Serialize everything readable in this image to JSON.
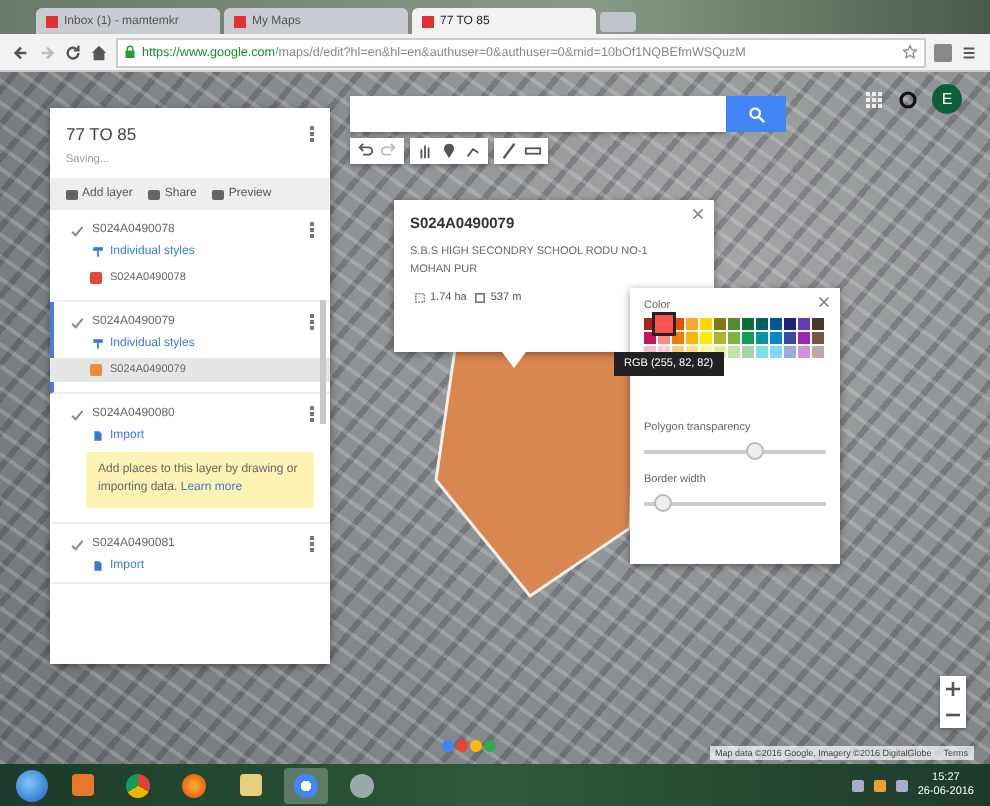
{
  "browser": {
    "tabs": [
      {
        "title": "Inbox (1) - mamtemkr",
        "selected": false
      },
      {
        "title": "My Maps",
        "selected": false
      },
      {
        "title": "77 TO 85",
        "selected": true
      }
    ],
    "url_host": "https://www.google.com",
    "url_path": "/maps/d/edit?hl=en&hl=en&authuser=0&authuser=0&mid=10bOf1NQBEfmWSQuzM"
  },
  "account": {
    "initial": "E"
  },
  "map_panel": {
    "title": "77 TO 85",
    "status": "Saving...",
    "actions": [
      "Add layer",
      "Share",
      "Preview"
    ],
    "layers": [
      {
        "name": "S024A0490078",
        "checked": true,
        "selected": false,
        "kind": "styled",
        "style_label": "Individual styles",
        "feature": {
          "name": "S024A0490078",
          "color": "#e04a3a",
          "selected": false
        }
      },
      {
        "name": "S024A0490079",
        "checked": true,
        "selected": true,
        "kind": "styled",
        "style_label": "Individual styles",
        "feature": {
          "name": "S024A0490079",
          "color": "#f08a3c",
          "selected": true
        }
      },
      {
        "name": "S024A0490080",
        "checked": true,
        "selected": false,
        "kind": "empty",
        "import_label": "Import",
        "note": "Add places to this layer by drawing or importing data.",
        "note_link": "Learn more"
      },
      {
        "name": "S024A0490081",
        "checked": true,
        "selected": false,
        "kind": "import",
        "import_label": "Import"
      }
    ]
  },
  "info_popup": {
    "title": "S024A0490079",
    "description": "S.B.S HIGH SECONDRY SCHOOL RODU NO-1 MOHAN PUR",
    "area": "1.74 ha",
    "perimeter": "537 m"
  },
  "color_picker": {
    "label": "Color",
    "tooltip": "RGB (255, 82, 82)",
    "rows": [
      [
        {
          "color": "#a52714",
          "selected": false
        },
        {
          "color": "#ff5252",
          "selected": true
        },
        {
          "color": "#e65100",
          "selected": false
        },
        {
          "color": "#f9a825",
          "selected": false
        },
        {
          "color": "#ffd600",
          "selected": false
        },
        {
          "color": "#817717",
          "selected": false
        },
        {
          "color": "#558b2f",
          "selected": false
        },
        {
          "color": "#097138",
          "selected": false
        },
        {
          "color": "#006064",
          "selected": false
        },
        {
          "color": "#01579b",
          "selected": false
        },
        {
          "color": "#1a237e",
          "selected": false
        },
        {
          "color": "#673ab7",
          "selected": false
        },
        {
          "color": "#4e342e",
          "selected": false
        }
      ],
      [
        {
          "color": "#c2185b",
          "selected": false
        },
        {
          "color": "#ff8a80",
          "selected": false
        },
        {
          "color": "#f57c00",
          "selected": false
        },
        {
          "color": "#ffb300",
          "selected": false
        },
        {
          "color": "#ffea00",
          "selected": false
        },
        {
          "color": "#afb42b",
          "selected": false
        },
        {
          "color": "#7cb342",
          "selected": false
        },
        {
          "color": "#0f9d58",
          "selected": false
        },
        {
          "color": "#0097a7",
          "selected": false
        },
        {
          "color": "#0288d1",
          "selected": false
        },
        {
          "color": "#3949ab",
          "selected": false
        },
        {
          "color": "#9c27b0",
          "selected": false
        },
        {
          "color": "#795548",
          "selected": false
        }
      ],
      [
        {
          "color": "#f8bbd0",
          "selected": false
        },
        {
          "color": "#ffcdd2",
          "selected": false
        },
        {
          "color": "#ffcc80",
          "selected": false
        },
        {
          "color": "#ffe082",
          "selected": false
        },
        {
          "color": "#fff59d",
          "selected": false
        },
        {
          "color": "#e6ee9c",
          "selected": false
        },
        {
          "color": "#c5e1a5",
          "selected": false
        },
        {
          "color": "#a5d6a7",
          "selected": false
        },
        {
          "color": "#80deea",
          "selected": false
        },
        {
          "color": "#81d4fa",
          "selected": false
        },
        {
          "color": "#9fa8da",
          "selected": false
        },
        {
          "color": "#ce93d8",
          "selected": false
        },
        {
          "color": "#bcaaa4",
          "selected": false
        }
      ]
    ],
    "sliders": [
      {
        "label": "Polygon transparency",
        "level": 0.6
      },
      {
        "label": "Border width",
        "level": 0.1
      }
    ]
  },
  "polygon": {
    "color": "#d9864f"
  },
  "map_footer": {
    "attribution": "Map data ©2016 Google, Imagery ©2016 DigitalGlobe",
    "terms": "Terms"
  },
  "taskbar": {
    "time": "15:27",
    "date": "26-06-2016"
  }
}
